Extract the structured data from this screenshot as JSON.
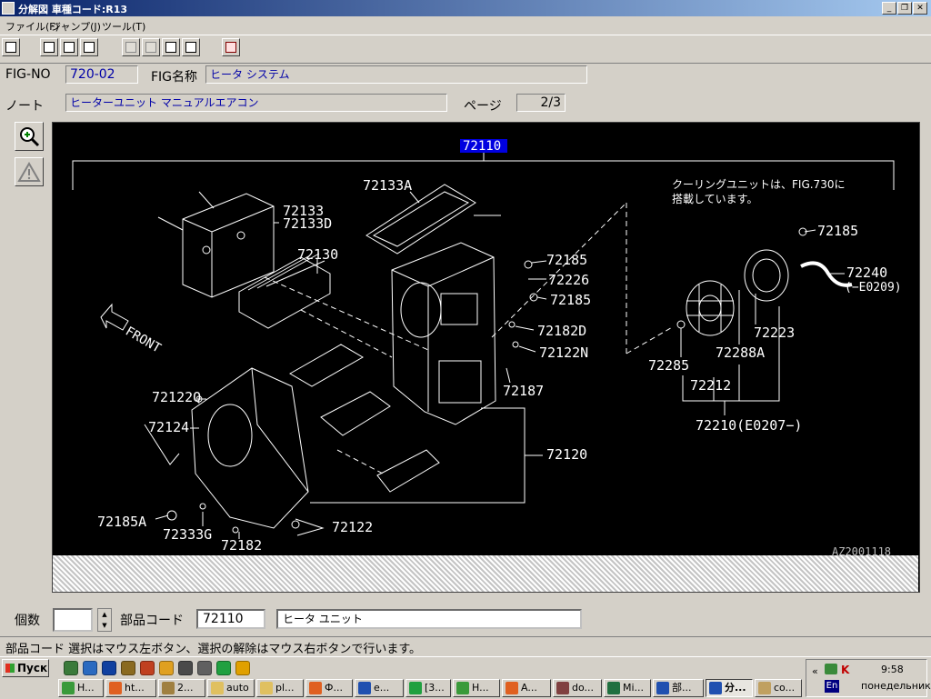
{
  "window": {
    "title": "分解図 車種コード:R13"
  },
  "menu": [
    "ファイル(F)",
    "ジャンプ(J)",
    "ツール(T)"
  ],
  "fig": {
    "label": "FIG-NO",
    "value": "720-02",
    "name_label": "FIG名称",
    "name_value": "ヒータ システム"
  },
  "note": {
    "label": "ノート",
    "value": "ヒーターユニット マニュアルエアコン"
  },
  "page": {
    "label": "ページ",
    "value": "2/3"
  },
  "diagram": {
    "header_part": "72110",
    "note_line1": "クーリングユニットは、FIG.730に",
    "note_line2": "搭載しています。",
    "front": "FRONT",
    "code": "AZ2001118",
    "parts": [
      "72133A",
      "72133D",
      "72133",
      "72130",
      "72185",
      "72226",
      "72185",
      "72182D",
      "72122N",
      "72187",
      "72122Q",
      "72124",
      "72120",
      "72185A",
      "72333G",
      "72182",
      "72122",
      "72185",
      "72240",
      "(−E0209)",
      "72223",
      "72288A",
      "72285",
      "72212",
      "72210(E0207−)"
    ]
  },
  "bottom": {
    "qty_label": "個数",
    "qty_value": "",
    "code_label": "部品コード",
    "code_value": "72110",
    "part_name": "ヒータ ユニット"
  },
  "status": "部品コード 選択はマウス左ボタン、選択の解除はマウス右ボタンで行います。",
  "taskbar": {
    "start": "Пуск",
    "row2": [
      "H...",
      "ht...",
      "2...",
      "auto",
      "pl...",
      "Ф...",
      "e...",
      "[3...",
      "H...",
      "A...",
      "do...",
      "Mi...",
      "部...",
      "分...",
      "co..."
    ],
    "tray_time": "9:58",
    "tray_day": "понедельник",
    "tray_lang": "En",
    "tray_chevron": "«"
  }
}
